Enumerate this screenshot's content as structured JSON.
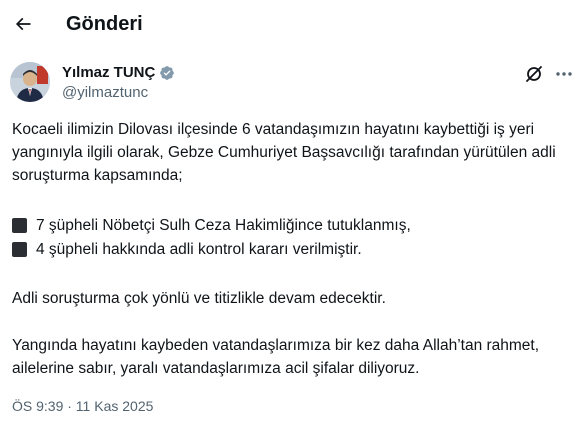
{
  "header": {
    "back_icon": "arrow-left-icon",
    "title": "Gönderi"
  },
  "author": {
    "name": "Yılmaz TUNÇ",
    "handle": "@yilmaztunc",
    "verified_color": "#829aab",
    "grok_icon": "grok-icon",
    "more_icon": "more-horizontal-icon"
  },
  "post": {
    "paragraph1": "Kocaeli ilimizin Dilovası ilçesinde 6 vatandaşımızın hayatını kaybettiği iş yeri yangınıyla ilgili olarak, Gebze Cumhuriyet Başsavcılığı tarafından yürütülen adli soruşturma kapsamında;",
    "bullets": [
      "7 şüpheli Nöbetçi Sulh Ceza Hakimliğince tutuklanmış,",
      "4 şüpheli hakkında adli kontrol kararı verilmiştir."
    ],
    "paragraph3": "Adli soruşturma çok yönlü ve titizlikle devam edecektir.",
    "paragraph4": "Yangında hayatını kaybeden vatandaşlarımıza bir kez daha Allah’tan rahmet, ailelerine sabır, yaralı vatandaşlarımıza acil şifalar diliyoruz.",
    "timestamp": "ÖS 9:39 · 11 Kas 2025"
  }
}
